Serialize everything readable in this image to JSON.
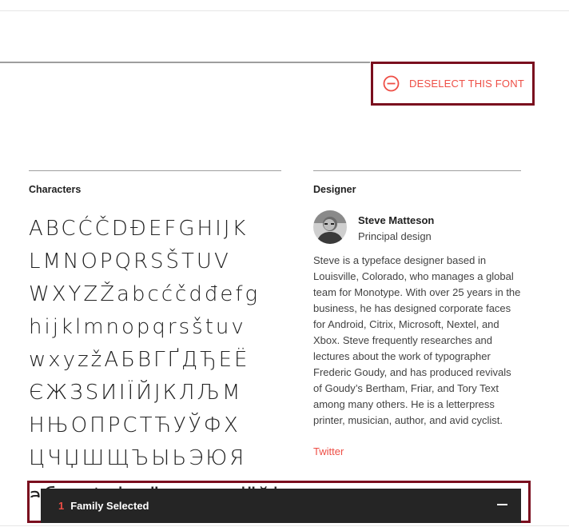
{
  "action": {
    "deselect_label": "DESELECT THIS FONT",
    "icon": "remove-circle-icon",
    "color": "#ee4e45"
  },
  "characters": {
    "heading": "Characters",
    "lines": [
      "ABCĆČDĐEFGHIJK",
      "LMNOPQRSŠTUV",
      "WXYZŽabcćčdđefg",
      "hijklmnopqrsštuv",
      "wxyzžАБВГҐДЂЕЁ",
      "ЄЖЗЅИІЇЙЈКЛЉМ",
      "НЊОПРСТЋУЎФХ",
      "ЦЧЏШЩЪЫЬЭЮЯ",
      "абвгґдђеёєжзѕиіїйј"
    ]
  },
  "designer": {
    "heading": "Designer",
    "name": "Steve Matteson",
    "role": "Principal design",
    "bio": "Steve is a typeface designer based in Louisville, Colorado, who manages a global team for Monotype. With over 25 years in the business, he has designed corporate faces for Android, Citrix, Microsoft, Nextel, and Xbox. Steve frequently researches and lectures about the work of typographer Frederic Goudy, and has produced revivals of Goudy’s Bertham, Friar, and Tory Text among many others. He is a letterpress printer, musician, author, and avid cyclist.",
    "link": "Twitter",
    "avatar_icon": "designer-photo"
  },
  "tray": {
    "count": "1",
    "label": "Family Selected",
    "minimize_icon": "minimize-icon"
  },
  "colors": {
    "accent": "#ee4e45",
    "highlight_border": "#7a0e1e",
    "tray_bg": "#252525"
  }
}
